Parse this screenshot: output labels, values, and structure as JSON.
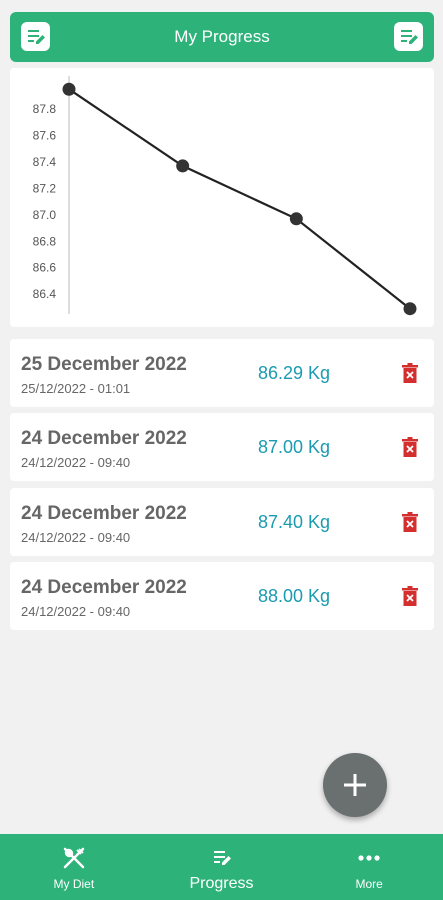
{
  "header": {
    "title": "My Progress",
    "left_icon": "edit-note-icon",
    "right_icon": "edit-note-icon",
    "color": "#2db37a"
  },
  "chart_data": {
    "type": "line",
    "x": [
      "24/12/2022 - 09:40",
      "24/12/2022 - 09:40",
      "24/12/2022 - 09:40",
      "25/12/2022 - 01:01"
    ],
    "y": [
      87.95,
      87.37,
      86.97,
      86.29
    ],
    "yticks": [
      "86.4",
      "86.6",
      "86.8",
      "87.0",
      "87.2",
      "87.4",
      "87.6",
      "87.8"
    ],
    "ylim": [
      86.25,
      88.05
    ],
    "grid": false
  },
  "entries": [
    {
      "date": "25 December 2022",
      "time": "25/12/2022 - 01:01",
      "weight": "86.29 Kg"
    },
    {
      "date": "24 December 2022",
      "time": "24/12/2022 - 09:40",
      "weight": "87.00 Kg"
    },
    {
      "date": "24 December 2022",
      "time": "24/12/2022 - 09:40",
      "weight": "87.40 Kg"
    },
    {
      "date": "24 December 2022",
      "time": "24/12/2022 - 09:40",
      "weight": "88.00 Kg"
    }
  ],
  "delete_icon": "trash-icon",
  "delete_color": "#d32f2f",
  "weight_color": "#1a9bb0",
  "fab": {
    "icon": "plus-icon"
  },
  "bottom_nav": {
    "items": [
      {
        "label": "My Diet",
        "icon": "fork-knife-icon"
      },
      {
        "label": "Progress",
        "icon": "edit-note-icon",
        "active": true
      },
      {
        "label": "More",
        "icon": "more-dots-icon"
      }
    ]
  }
}
